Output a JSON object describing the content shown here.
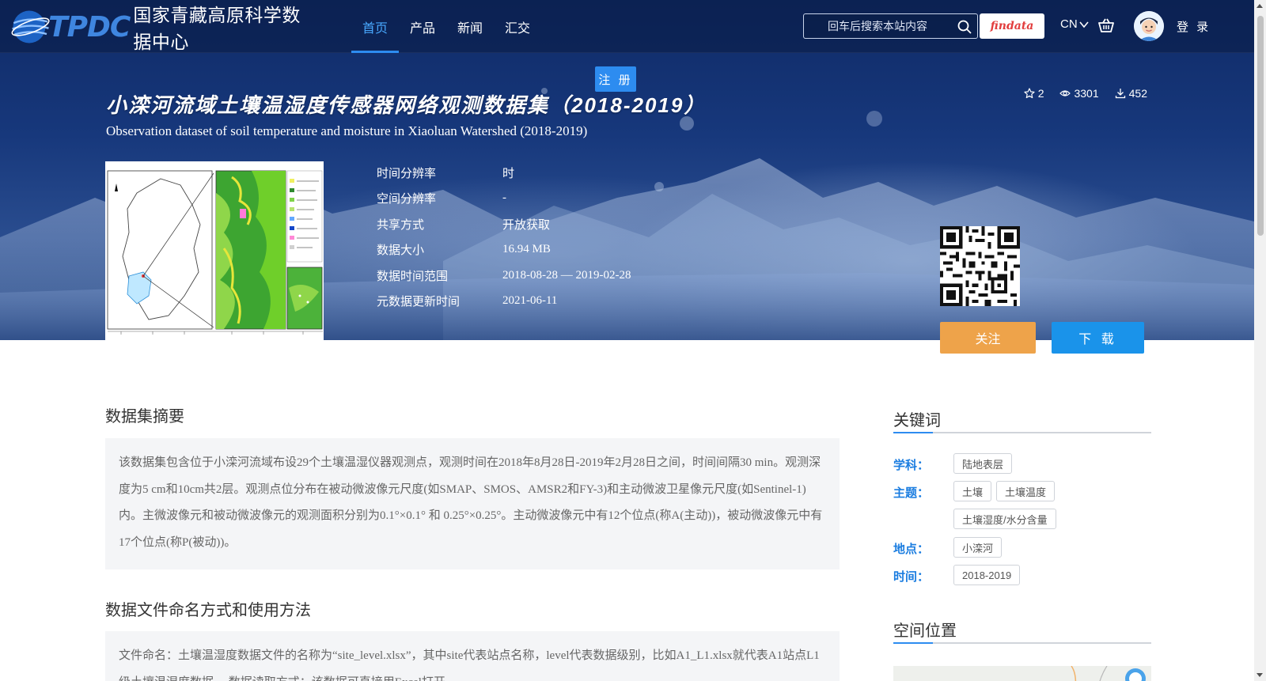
{
  "header": {
    "logo_letters": "TPDC",
    "logo_name": "国家青藏高原科学数据中心",
    "nav": [
      {
        "label": "首页",
        "active": true
      },
      {
        "label": "产品",
        "active": false
      },
      {
        "label": "新闻",
        "active": false
      },
      {
        "label": "汇交",
        "active": false
      }
    ],
    "search_placeholder": "回车后搜索本站内容",
    "findata_label": "findata",
    "lang_label": "CN",
    "login_label": "登 录",
    "register_label": "注 册"
  },
  "dataset": {
    "title_cn": "小滦河流域土壤温湿度传感器网络观测数据集（2018-2019）",
    "title_en": "Observation dataset of soil temperature and moisture in Xiaoluan Watershed (2018-2019)",
    "stats": {
      "stars": "2",
      "views": "3301",
      "downloads": "452"
    },
    "meta": [
      {
        "key": "时间分辨率",
        "value": "时"
      },
      {
        "key": "空间分辨率",
        "value": "-"
      },
      {
        "key": "共享方式",
        "value": "开放获取"
      },
      {
        "key": "数据大小",
        "value": "16.94 MB"
      },
      {
        "key": "数据时间范围",
        "value": "2018-08-28 — 2019-02-28"
      },
      {
        "key": "元数据更新时间",
        "value": "2021-06-11"
      }
    ],
    "follow_label": "关注",
    "download_label": "下 载"
  },
  "content": {
    "abstract_heading": "数据集摘要",
    "abstract_text": "该数据集包含位于小滦河流域布设29个土壤温湿仪器观测点，观测时间在2018年8月28日-2019年2月28日之间，时间间隔30 min。观测深度为5 cm和10cm共2层。观测点位分布在被动微波像元尺度(如SMAP、SMOS、AMSR2和FY-3)和主动微波卫星像元尺度(如Sentinel-1)内。主微波像元和被动微波像元的观测面积分别为0.1°×0.1° 和 0.25°×0.25°。主动微波像元中有12个位点(称A(主动))，被动微波像元中有17个位点(称P(被动))。",
    "file_heading": "数据文件命名方式和使用方法",
    "file_text": "文件命名：土壤温湿度数据文件的名称为“site_level.xlsx”，其中site代表站点名称，level代表数据级别，比如A1_L1.xlsx就代表A1站点L1级土壤温湿度数据。 数据读取方式：该数据可直接用Excel打开。"
  },
  "sidebar": {
    "keywords_heading": "关键词",
    "keywords": {
      "discipline_label": "学科：",
      "discipline_tags": [
        "陆地表层"
      ],
      "theme_label": "主题：",
      "theme_tags": [
        "土壤",
        "土壤温度",
        "土壤湿度/水分含量"
      ],
      "place_label": "地点：",
      "place_tags": [
        "小滦河"
      ],
      "time_label": "时间：",
      "time_tags": [
        "2018-2019"
      ]
    },
    "location_heading": "空间位置"
  },
  "colors": {
    "accent": "#2d8cf0",
    "follow": "#eea34a",
    "download": "#1a93ea",
    "keyword_label": "#1b7de0"
  }
}
